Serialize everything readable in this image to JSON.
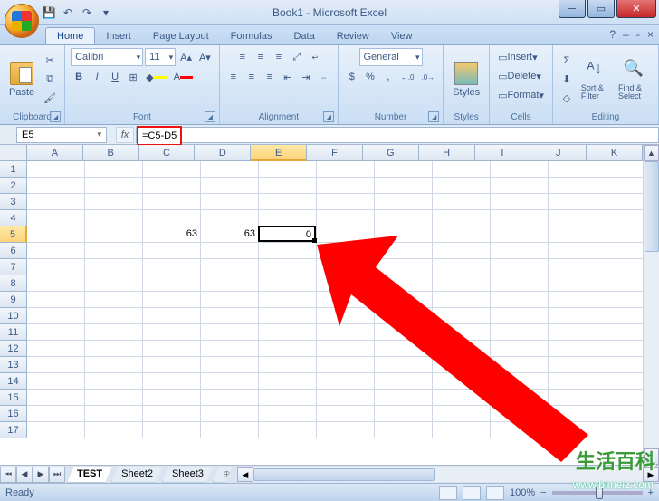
{
  "window": {
    "title": "Book1 - Microsoft Excel"
  },
  "qat": {
    "save": "💾",
    "undo": "↶",
    "redo": "↷",
    "more": "▾"
  },
  "tabs": {
    "items": [
      "Home",
      "Insert",
      "Page Layout",
      "Formulas",
      "Data",
      "Review",
      "View"
    ],
    "active": 0,
    "help": "?",
    "minimize_ribbon": "–",
    "restore_app": "▫",
    "close_app": "×"
  },
  "ribbon": {
    "clipboard": {
      "label": "Clipboard",
      "paste": "Paste",
      "cut": "✂",
      "copy": "⧉",
      "format_painter": "🖌"
    },
    "font": {
      "label": "Font",
      "family": "Calibri",
      "size": "11",
      "grow": "A▴",
      "shrink": "A▾",
      "bold": "B",
      "italic": "I",
      "underline": "U",
      "border": "⊞",
      "fill": "◆",
      "color": "A"
    },
    "alignment": {
      "label": "Alignment",
      "top": "≡",
      "middle": "≡",
      "bottom": "≡",
      "left": "≡",
      "center": "≡",
      "right": "≡",
      "decrease_indent": "⇤",
      "increase_indent": "⇥",
      "orientation": "⤢",
      "wrap": "Wrap Text",
      "merge": "Merge & Center"
    },
    "number": {
      "label": "Number",
      "format": "General",
      "currency": "$",
      "percent": "%",
      "comma": ",",
      "inc_dec": ".0→.00",
      "dec_dec": ".00→.0"
    },
    "styles": {
      "label": "Styles",
      "styles": "Styles",
      "cond_fmt": "▦",
      "table": "▦",
      "cell": "▦"
    },
    "cells": {
      "label": "Cells",
      "insert": "Insert",
      "delete": "Delete",
      "format": "Format"
    },
    "editing": {
      "label": "Editing",
      "autosum": "Σ",
      "fill": "⬇",
      "clear": "◇",
      "sort": "Sort & Filter",
      "find": "Find & Select"
    }
  },
  "formula_bar": {
    "name_box": "E5",
    "cancel": "✕",
    "enter": "✓",
    "fx": "fx",
    "formula": "=C5-D5"
  },
  "grid": {
    "columns": [
      "A",
      "B",
      "C",
      "D",
      "E",
      "F",
      "G",
      "H",
      "I",
      "J",
      "K"
    ],
    "rows": [
      1,
      2,
      3,
      4,
      5,
      6,
      7,
      8,
      9,
      10,
      11,
      12,
      13,
      14,
      15,
      16,
      17
    ],
    "active_col": "E",
    "active_row": 5,
    "data": {
      "C5": "63",
      "D5": "63",
      "E5": "0"
    }
  },
  "sheets": {
    "nav": {
      "first": "⏮",
      "prev": "◀",
      "next": "▶",
      "last": "⏭"
    },
    "tabs": [
      "TEST",
      "Sheet2",
      "Sheet3"
    ],
    "active": 0,
    "new": "⊕"
  },
  "status": {
    "mode": "Ready",
    "zoom": "100%",
    "zoom_out": "−",
    "zoom_in": "+"
  },
  "watermark": {
    "text": "生活百科",
    "url": "www.bimeiz.com"
  }
}
